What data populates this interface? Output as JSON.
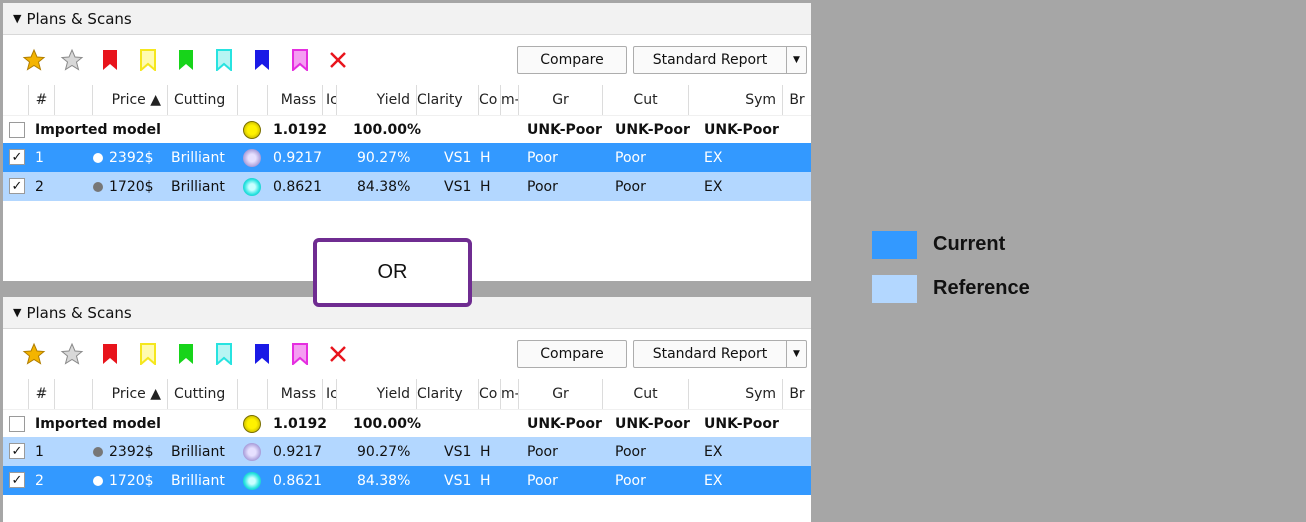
{
  "panels": [
    {
      "title": "Plans & Scans",
      "compare_label": "Compare",
      "report_label": "Standard Report",
      "headers": [
        "#",
        "Price ▲",
        "Cutting",
        "Mass",
        "Ic",
        "Yield",
        "Clarity",
        "Co",
        "m-",
        "Gr",
        "Cut",
        "Sym",
        "Br"
      ],
      "imported": {
        "label": "Imported model",
        "mass": "1.0192",
        "yield": "100.00%",
        "gr": "UNK-Poor",
        "cut": "UNK-Poor",
        "sym": "UNK-Poor"
      },
      "rows": [
        {
          "num": "1",
          "price": "2392$",
          "cutting": "Brilliant",
          "mass": "0.9217",
          "yield": "90.27%",
          "clarity": "VS1",
          "color": "H",
          "gr": "Poor",
          "cut": "Poor",
          "sym": "EX",
          "state": "current",
          "checked": "✓"
        },
        {
          "num": "2",
          "price": "1720$",
          "cutting": "Brilliant",
          "mass": "0.8621",
          "yield": "84.38%",
          "clarity": "VS1",
          "color": "H",
          "gr": "Poor",
          "cut": "Poor",
          "sym": "EX",
          "state": "reference",
          "checked": "✓"
        }
      ]
    },
    {
      "title": "Plans & Scans",
      "compare_label": "Compare",
      "report_label": "Standard Report",
      "headers": [
        "#",
        "Price ▲",
        "Cutting",
        "Mass",
        "Ic",
        "Yield",
        "Clarity",
        "Co",
        "m-",
        "Gr",
        "Cut",
        "Sym",
        "Br"
      ],
      "imported": {
        "label": "Imported model",
        "mass": "1.0192",
        "yield": "100.00%",
        "gr": "UNK-Poor",
        "cut": "UNK-Poor",
        "sym": "UNK-Poor"
      },
      "rows": [
        {
          "num": "1",
          "price": "2392$",
          "cutting": "Brilliant",
          "mass": "0.9217",
          "yield": "90.27%",
          "clarity": "VS1",
          "color": "H",
          "gr": "Poor",
          "cut": "Poor",
          "sym": "EX",
          "state": "reference",
          "checked": "✓"
        },
        {
          "num": "2",
          "price": "1720$",
          "cutting": "Brilliant",
          "mass": "0.8621",
          "yield": "84.38%",
          "clarity": "VS1",
          "color": "H",
          "gr": "Poor",
          "cut": "Poor",
          "sym": "EX",
          "state": "current",
          "checked": "✓"
        }
      ]
    }
  ],
  "toolbar_icons": [
    "gold-star-icon",
    "gray-star-icon",
    "red-flag-icon",
    "yellow-flag-icon",
    "green-flag-icon",
    "cyan-flag-icon",
    "blue-flag-icon",
    "magenta-flag-icon",
    "red-x-icon"
  ],
  "flag_colors": [
    "#e8141c",
    "#f5e71e",
    "#17d41a",
    "#27e3e0",
    "#1a1ae6",
    "#e52ee0"
  ],
  "or_label": "OR",
  "legend": [
    {
      "label": "Current",
      "color": "#3399ff"
    },
    {
      "label": "Reference",
      "color": "#b3d7ff"
    }
  ],
  "colors": {
    "current": "#3399ff",
    "reference": "#b3d7ff",
    "or_border": "#6f2c91",
    "background": "#a6a6a6"
  }
}
